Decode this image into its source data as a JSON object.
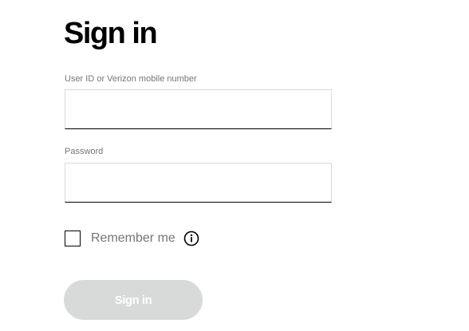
{
  "page": {
    "title": "Sign in"
  },
  "form": {
    "user_id": {
      "label": "User ID or Verizon mobile number",
      "value": ""
    },
    "password": {
      "label": "Password",
      "value": ""
    },
    "remember_me": {
      "label": "Remember me",
      "checked": false,
      "info_icon": "info-icon"
    },
    "submit": {
      "label": "Sign in",
      "enabled": false
    }
  },
  "colors": {
    "label_gray": "#747676",
    "input_border": "#d8dada",
    "disabled_button_bg": "#d8dada",
    "text_black": "#000000"
  }
}
